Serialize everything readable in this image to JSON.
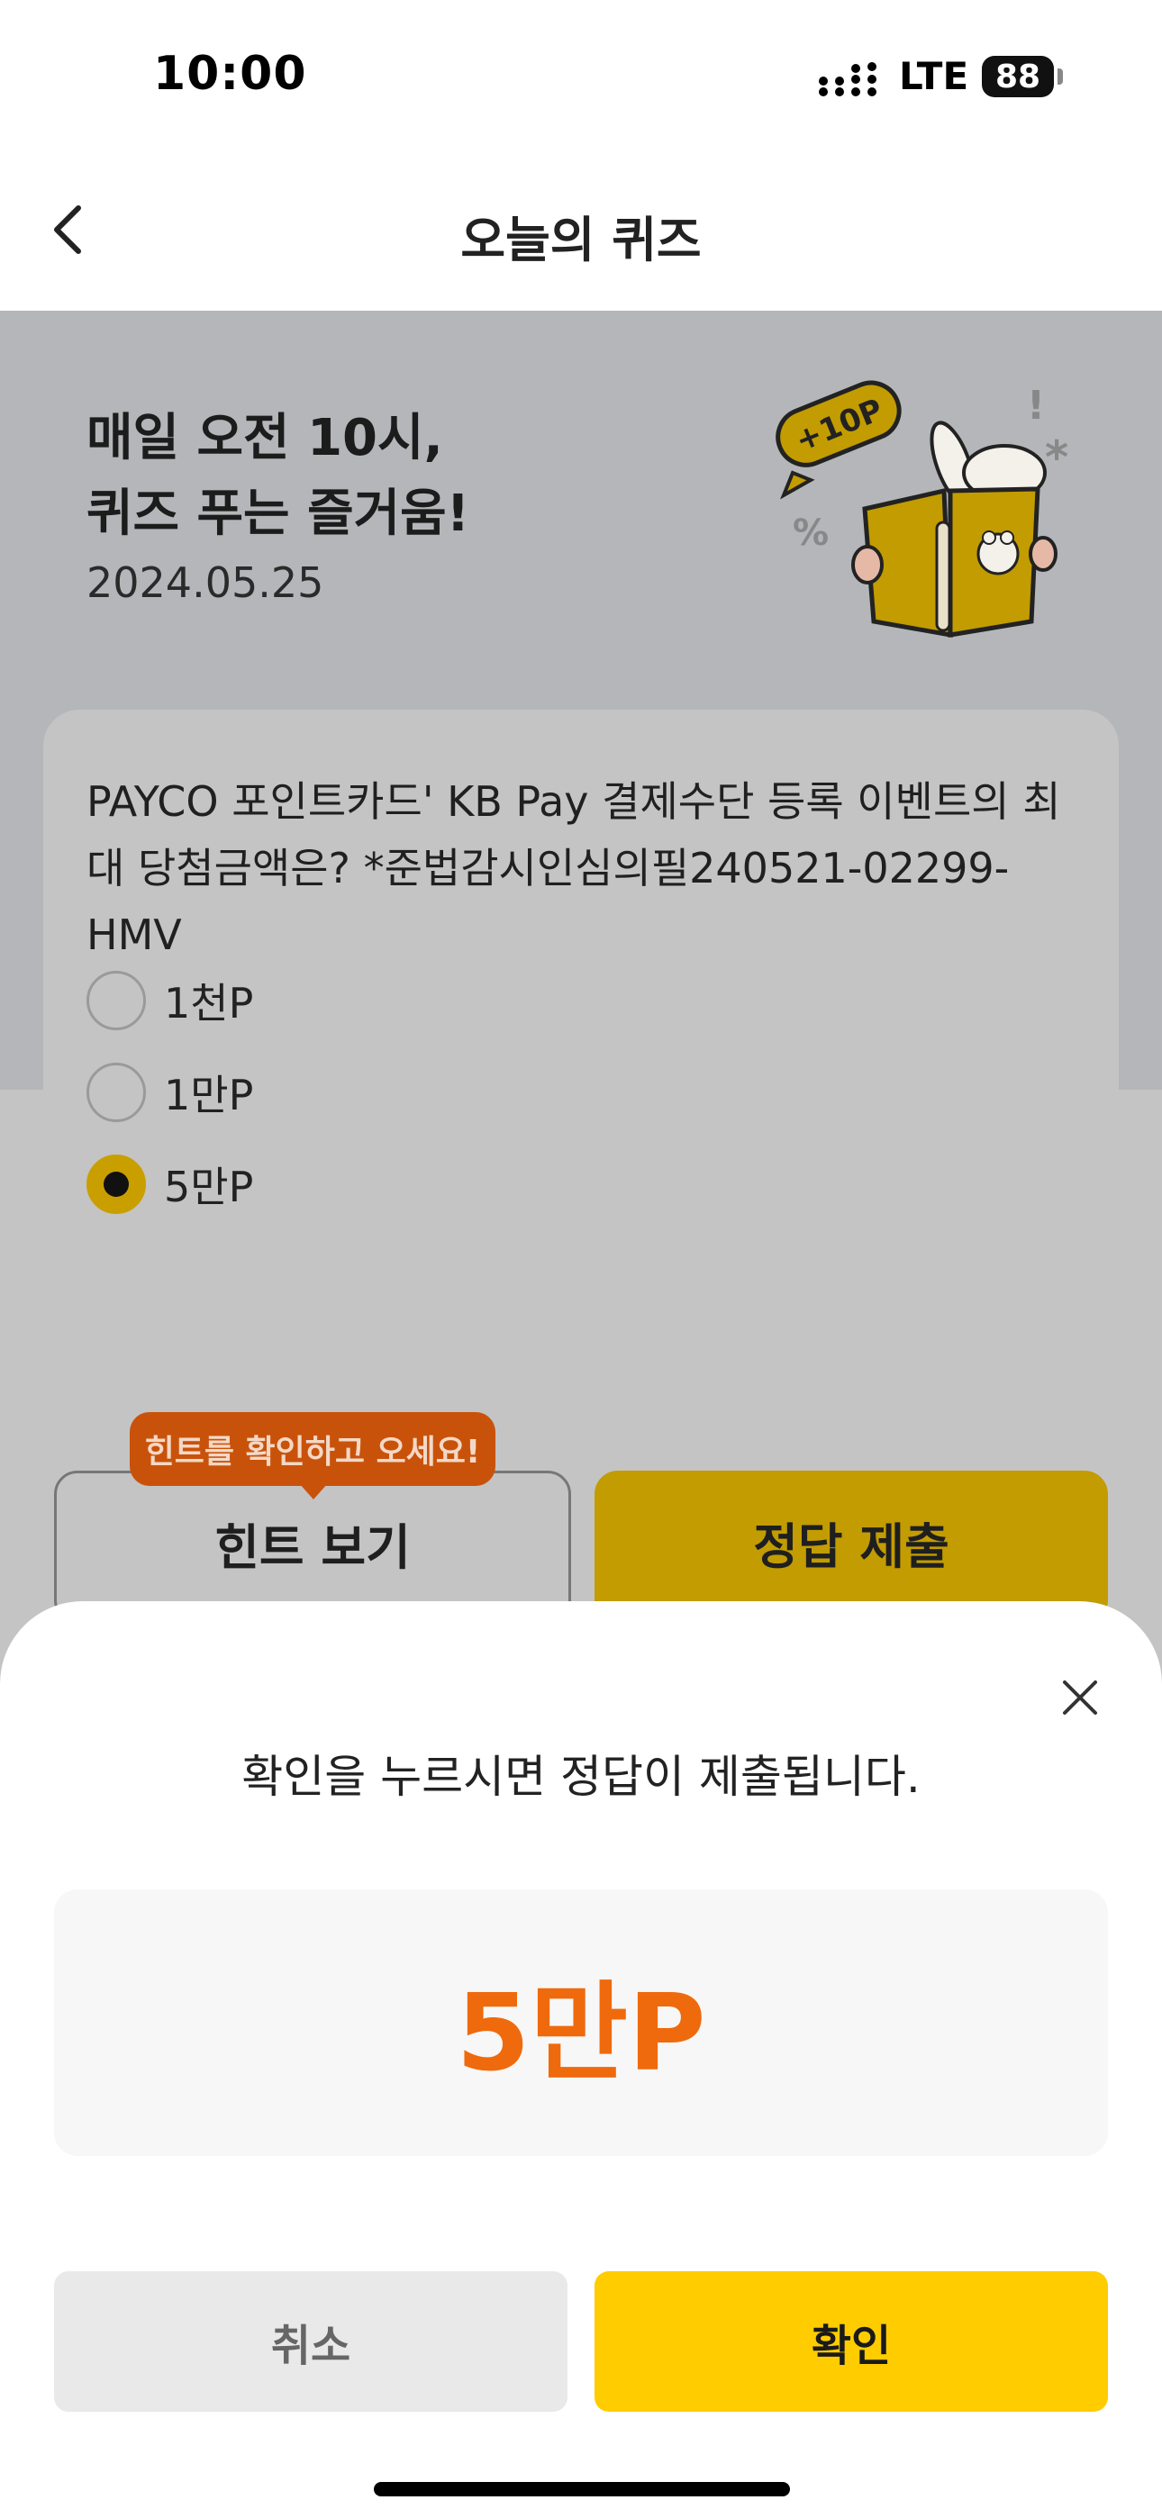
{
  "status_bar": {
    "time": "10:00",
    "network": "LTE",
    "battery": "88"
  },
  "header": {
    "title": "오늘의 퀴즈"
  },
  "hero": {
    "title": "매일 오전 10시,\n퀴즈 푸는 즐거움!",
    "date": "2024.05.25",
    "badge": "+10P"
  },
  "quiz": {
    "question": "PAYCO 포인트카드' KB Pay 결제수단 등록 이벤트의 최대 당첨금액은? *준법감시인심의필240521-02299-HMV",
    "options": [
      {
        "label": "1천P",
        "selected": false
      },
      {
        "label": "1만P",
        "selected": false
      },
      {
        "label": "5만P",
        "selected": true
      }
    ],
    "hint_tooltip": "힌트를 확인하고 오세요!",
    "hint_button": "힌트 보기",
    "submit_button": "정답 제출"
  },
  "sheet": {
    "message": "확인을 누르시면 정답이 제출됩니다.",
    "answer": "5만P",
    "cancel_button": "취소",
    "confirm_button": "확인"
  },
  "colors": {
    "accent": "#FFCC00",
    "answer": "#EF6A0C",
    "tooltip": "#C9520A"
  }
}
